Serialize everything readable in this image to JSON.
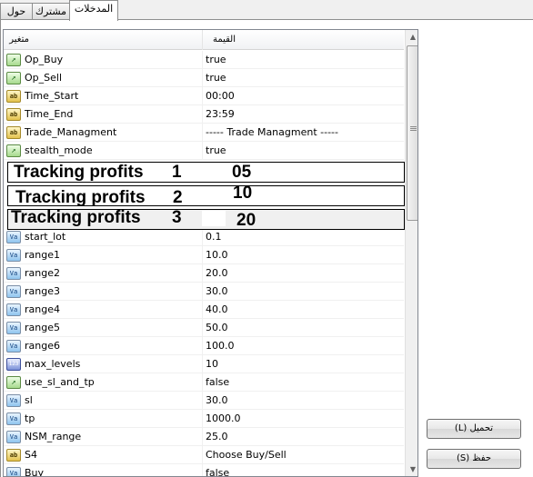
{
  "tabs": [
    {
      "label": "المدخلات"
    },
    {
      "label": "مشترك"
    },
    {
      "label": "حول"
    }
  ],
  "grid": {
    "header": {
      "name_label": "متغير",
      "value_label": "القيمة"
    },
    "rows_top": [
      {
        "icon": "bool-icon",
        "glyph": "↗",
        "name": "Op_Buy",
        "value": "true"
      },
      {
        "icon": "bool-icon",
        "glyph": "↗",
        "name": "Op_Sell",
        "value": "true"
      },
      {
        "icon": "ab-icon",
        "glyph": "ab",
        "name": "Time_Start",
        "value": "00:00"
      },
      {
        "icon": "ab-icon",
        "glyph": "ab",
        "name": "Time_End",
        "value": "23:59"
      },
      {
        "icon": "ab-icon",
        "glyph": "ab",
        "name": "Trade_Managment",
        "value": "----- Trade Managment -----"
      },
      {
        "icon": "bool-icon",
        "glyph": "↗",
        "name": "stealth_mode",
        "value": "true"
      }
    ],
    "tracking_profits": [
      {
        "label": "Tracking profits",
        "index": "1",
        "value": "05"
      },
      {
        "label": "Tracking profits",
        "index": "2",
        "value": "10"
      },
      {
        "label": "Tracking profits",
        "index": "3",
        "value": "20"
      }
    ],
    "rows_bottom": [
      {
        "icon": "va-icon",
        "glyph": "Va",
        "name": "start_lot",
        "value": "0.1"
      },
      {
        "icon": "va-icon",
        "glyph": "Va",
        "name": "range1",
        "value": "10.0"
      },
      {
        "icon": "va-icon",
        "glyph": "Va",
        "name": "range2",
        "value": "20.0"
      },
      {
        "icon": "va-icon",
        "glyph": "Va",
        "name": "range3",
        "value": "30.0"
      },
      {
        "icon": "va-icon",
        "glyph": "Va",
        "name": "range4",
        "value": "40.0"
      },
      {
        "icon": "va-icon",
        "glyph": "Va",
        "name": "range5",
        "value": "50.0"
      },
      {
        "icon": "va-icon",
        "glyph": "Va",
        "name": "range6",
        "value": "100.0"
      },
      {
        "icon": "num-icon",
        "glyph": "123",
        "name": "max_levels",
        "value": "10"
      },
      {
        "icon": "bool-icon",
        "glyph": "↗",
        "name": "use_sl_and_tp",
        "value": "false"
      },
      {
        "icon": "va-icon",
        "glyph": "Va",
        "name": "sl",
        "value": "30.0"
      },
      {
        "icon": "va-icon",
        "glyph": "Va",
        "name": "tp",
        "value": "1000.0"
      },
      {
        "icon": "va-icon",
        "glyph": "Va",
        "name": "NSM_range",
        "value": "25.0"
      },
      {
        "icon": "ab-icon",
        "glyph": "ab",
        "name": "S4",
        "value": "Choose Buy/Sell"
      },
      {
        "icon": "va-icon",
        "glyph": "Va",
        "name": "Buy",
        "value": "false"
      }
    ]
  },
  "scrollbar": {
    "up_arrow": "▲",
    "down_arrow": "▼"
  },
  "buttons": {
    "load_label": "تحميل (L)",
    "save_label": "حفظ (S)"
  }
}
